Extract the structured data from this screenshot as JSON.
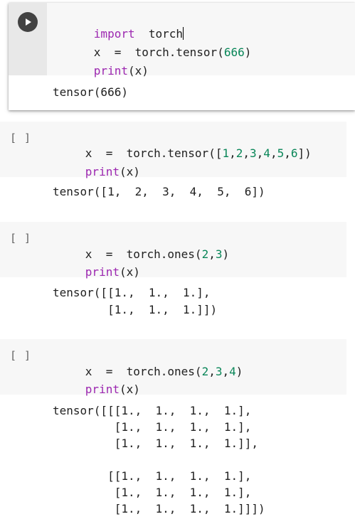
{
  "cells": [
    {
      "bracket": "",
      "code": [
        {
          "parts": [
            {
              "t": "import",
              "c": "kw"
            },
            {
              "t": "  torch",
              "c": "plain"
            }
          ]
        },
        {
          "parts": [
            {
              "t": "x  =  torch.tensor(",
              "c": "plain"
            },
            {
              "t": "666",
              "c": "num"
            },
            {
              "t": ")",
              "c": "plain"
            }
          ]
        },
        {
          "parts": [
            {
              "t": "print",
              "c": "kw"
            },
            {
              "t": "(x)",
              "c": "plain"
            }
          ]
        }
      ],
      "output": [
        "tensor(666)"
      ]
    },
    {
      "bracket": "[ ]",
      "code": [
        {
          "parts": [
            {
              "t": "x  =  torch.tensor([",
              "c": "plain"
            },
            {
              "t": "1",
              "c": "num"
            },
            {
              "t": ",",
              "c": "plain"
            },
            {
              "t": "2",
              "c": "num"
            },
            {
              "t": ",",
              "c": "plain"
            },
            {
              "t": "3",
              "c": "num"
            },
            {
              "t": ",",
              "c": "plain"
            },
            {
              "t": "4",
              "c": "num"
            },
            {
              "t": ",",
              "c": "plain"
            },
            {
              "t": "5",
              "c": "num"
            },
            {
              "t": ",",
              "c": "plain"
            },
            {
              "t": "6",
              "c": "num"
            },
            {
              "t": "])",
              "c": "plain"
            }
          ]
        },
        {
          "parts": [
            {
              "t": "print",
              "c": "kw"
            },
            {
              "t": "(x)",
              "c": "plain"
            }
          ]
        }
      ],
      "output": [
        "tensor([1,  2,  3,  4,  5,  6])"
      ]
    },
    {
      "bracket": "[ ]",
      "code": [
        {
          "parts": [
            {
              "t": "x  =  torch.ones(",
              "c": "plain"
            },
            {
              "t": "2",
              "c": "num"
            },
            {
              "t": ",",
              "c": "plain"
            },
            {
              "t": "3",
              "c": "num"
            },
            {
              "t": ")",
              "c": "plain"
            }
          ]
        },
        {
          "parts": [
            {
              "t": "print",
              "c": "kw"
            },
            {
              "t": "(x)",
              "c": "plain"
            }
          ]
        }
      ],
      "output": [
        "tensor([[1.,  1.,  1.],",
        "        [1.,  1.,  1.]])"
      ]
    },
    {
      "bracket": "[ ]",
      "code": [
        {
          "parts": [
            {
              "t": "x  =  torch.ones(",
              "c": "plain"
            },
            {
              "t": "2",
              "c": "num"
            },
            {
              "t": ",",
              "c": "plain"
            },
            {
              "t": "3",
              "c": "num"
            },
            {
              "t": ",",
              "c": "plain"
            },
            {
              "t": "4",
              "c": "num"
            },
            {
              "t": ")",
              "c": "plain"
            }
          ]
        },
        {
          "parts": [
            {
              "t": "print",
              "c": "kw"
            },
            {
              "t": "(x)",
              "c": "plain"
            }
          ]
        }
      ],
      "output": [
        "tensor([[[1.,  1.,  1.,  1.],",
        "         [1.,  1.,  1.,  1.],",
        "         [1.,  1.,  1.,  1.]],",
        "",
        "        [[1.,  1.,  1.,  1.],",
        "         [1.,  1.,  1.,  1.],",
        "         [1.,  1.,  1.,  1.]]])"
      ]
    }
  ],
  "colors": {
    "keyword": "#9c27b0",
    "number": "#098658",
    "code_bg": "#f7f7f7",
    "run_button": "#424242"
  },
  "icons": {
    "run": "play-icon"
  }
}
